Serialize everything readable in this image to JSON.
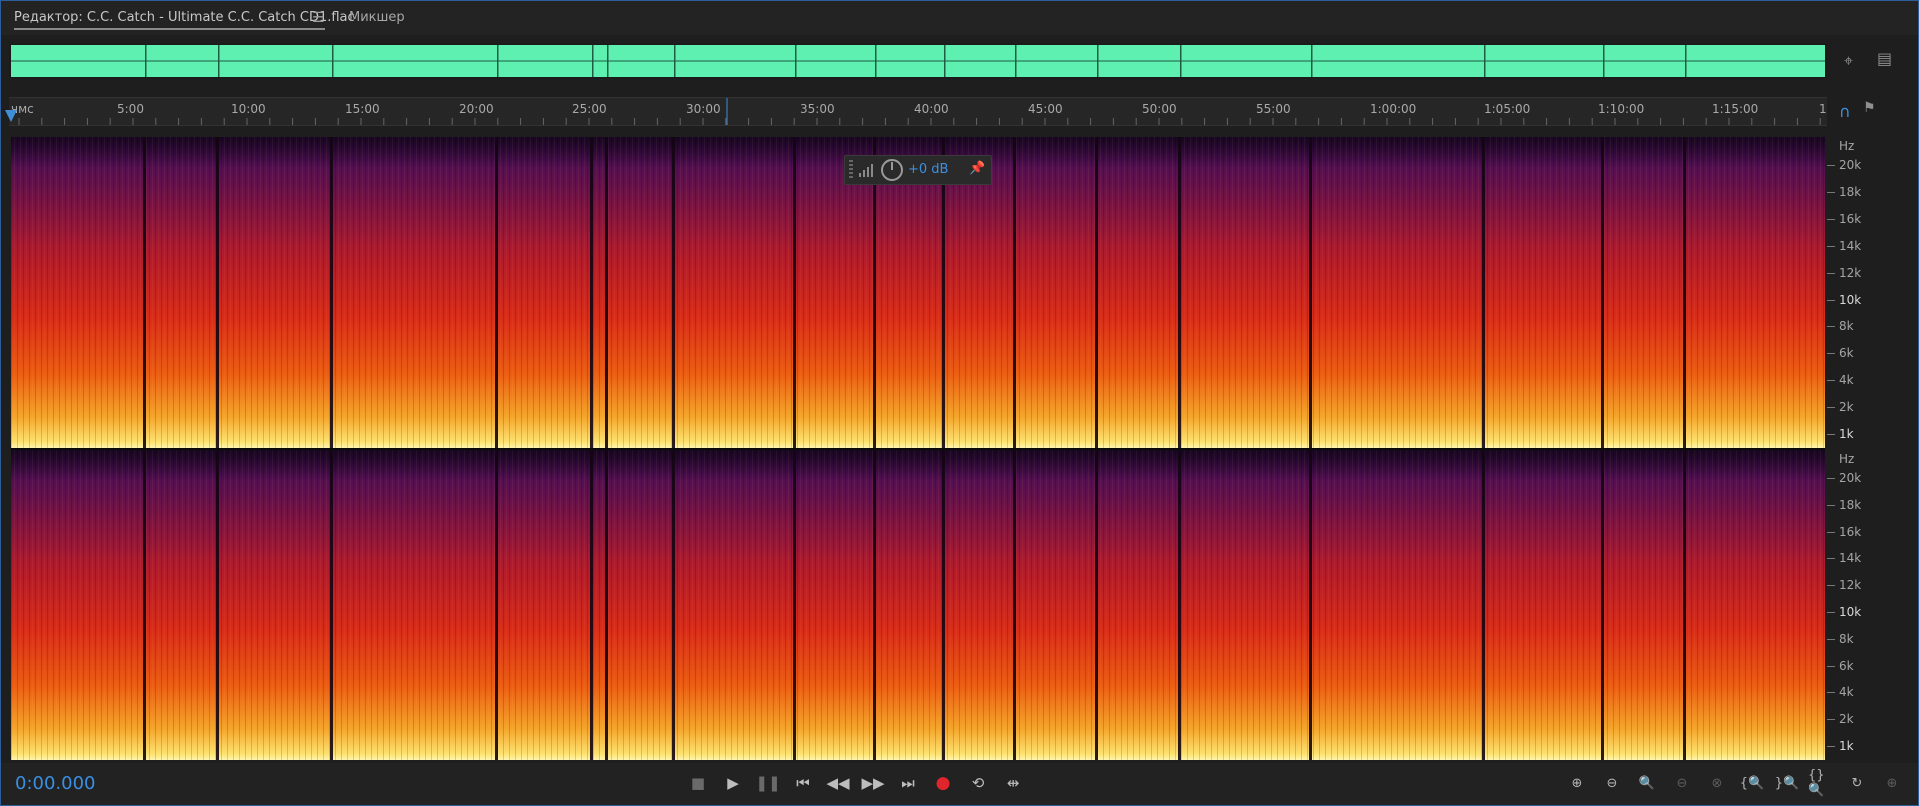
{
  "tabs": {
    "editor_label": "Редактор: C.C. Catch - Ultimate C.C. Catch CD1.flac",
    "menu_icon": "hamburger-icon",
    "mixer_label": "Микшер"
  },
  "ruler": {
    "ticks": [
      "чмс",
      "5:00",
      "10:00",
      "15:00",
      "20:00",
      "25:00",
      "30:00",
      "35:00",
      "40:00",
      "45:00",
      "50:00",
      "55:00",
      "1:00:00",
      "1:05:00",
      "1:10:00",
      "1:15:00",
      "1"
    ]
  },
  "frequency_axis": {
    "unit": "Hz",
    "labels": [
      "20k",
      "18k",
      "16k",
      "14k",
      "12k",
      "10k",
      "8k",
      "6k",
      "4k",
      "2k",
      "1k"
    ]
  },
  "hud": {
    "gain": "+0 dB"
  },
  "transport": {
    "time": "0:00.000",
    "buttons": [
      "stop-icon",
      "play-icon",
      "pause-icon",
      "skip-to-start-icon",
      "rewind-icon",
      "fast-forward-icon",
      "skip-to-end-icon",
      "record-icon",
      "loop-icon",
      "skip-selection-icon"
    ]
  },
  "colors": {
    "waveform": "#5ef0b0",
    "accent": "#3a8fe0",
    "record": "#e0262c"
  }
}
